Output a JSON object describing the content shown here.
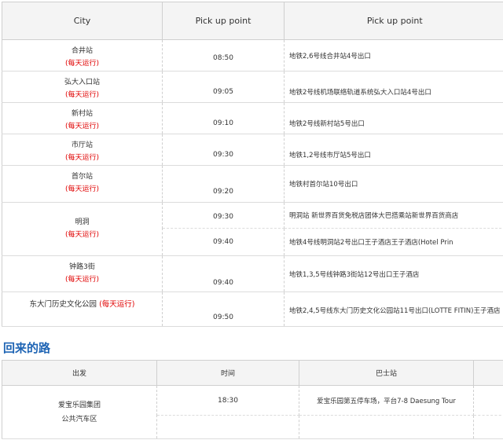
{
  "pickup_table": {
    "headers": [
      "City",
      "Pick up point",
      "Pick up point"
    ],
    "rows": [
      {
        "city": "合井站",
        "daily": "(每天运行)",
        "times": [
          "08:50"
        ],
        "points": [
          "地铁2,6号线合井站4号出口"
        ]
      },
      {
        "city": "弘大入口站",
        "daily": "(每天运行)",
        "times": [
          "09:05"
        ],
        "points": [
          "地铁2号线机场联络轨道系统弘大入口站4号出口"
        ]
      },
      {
        "city": "新村站",
        "daily": "(每天运行)",
        "times": [
          "09:10"
        ],
        "points": [
          "地铁2号线新村站5号出口"
        ]
      },
      {
        "city": "市厅站",
        "daily": "(每天运行)",
        "times": [
          "09:30"
        ],
        "points": [
          "地铁1,2号线市厅站5号出口"
        ]
      },
      {
        "city": "首尔站",
        "daily": "(每天运行)",
        "times": [
          "09:20"
        ],
        "points": [
          "地铁村首尔站10号出口"
        ]
      },
      {
        "city": "明洞",
        "daily": "(每天运行)",
        "times": [
          "09:30",
          "09:40"
        ],
        "points": [
          "明洞站 新世界百货免税店团体大巴搭乘站新世界百货商店",
          "地铁4号线明洞站2号出口王子酒店王子酒店(Hotel Prin"
        ]
      },
      {
        "city": "钟路3街",
        "daily": "(每天运行)",
        "times": [
          "09:40"
        ],
        "points": [
          "地铁1,3,5号线钟路3街站12号出口王子酒店"
        ]
      },
      {
        "city": "东大门历史文化公园",
        "daily": "(每天运行)",
        "times": [
          "09:50"
        ],
        "points": [
          "地铁2,4,5号线东大门历史文化公园站11号出口(LOTTE FITIN)王子酒店"
        ]
      }
    ]
  },
  "return_section": {
    "title": "回来的路",
    "headers": [
      "出发",
      "时间",
      "巴士站",
      ""
    ],
    "row": {
      "depart_line1": "爱宝乐园集团",
      "depart_line2": "公共汽车区",
      "time": "18:30",
      "stop": "爱宝乐园第五停车场，平台7-8 Daesung Tour"
    }
  },
  "colors": {
    "accent_blue": "#1e64b4",
    "daily_red": "#e00000",
    "header_bg": "#f4f4f4"
  }
}
